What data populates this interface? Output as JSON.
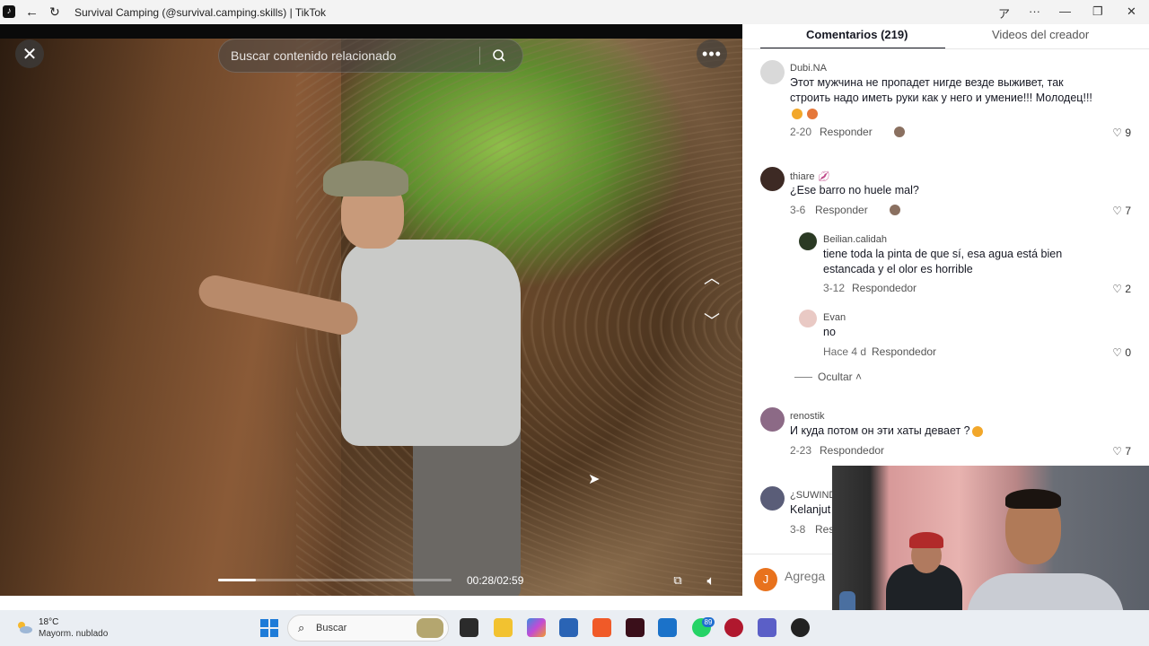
{
  "window": {
    "title": "Survival Camping (@survival.camping.skills) | TikTok"
  },
  "video": {
    "search_placeholder": "Buscar contenido relacionado",
    "time": "00:28/02:59",
    "progress_fraction": 0.16
  },
  "comments_panel": {
    "tabs": [
      {
        "label": "Comentarios (219)"
      },
      {
        "label": "Videos del creador"
      }
    ],
    "comments": [
      {
        "username": "Dubi.NA",
        "text": "Этот мужчина не пропадет нигде везде выживет, так строить надо иметь руки как у него и умение!!! Молодец!!!",
        "date": "2-20",
        "reply_label": "Responder",
        "likes": "9"
      },
      {
        "username": "thiare",
        "text": "¿Ese barro no huele mal?",
        "date": "3-6",
        "reply_label": "Responder",
        "likes": "7"
      },
      {
        "username": "Beilian.calidah",
        "text": "tiene toda la pinta de que sí, esa agua está bien estancada y el olor es horrible",
        "date": "3-12",
        "reply_label": "Respondedor",
        "likes": "2"
      },
      {
        "username": "Evan",
        "text": "no",
        "date": "Hace 4 d",
        "reply_label": "Respondedor",
        "likes": "0"
      },
      {
        "username": "renostik",
        "text": "И куда потом он эти хаты девает ?",
        "date": "2-23",
        "reply_label": "Respondedor",
        "likes": "7"
      },
      {
        "username": "¿SUWIND",
        "text": "Kelanjut",
        "date": "3-8",
        "reply_label": "Res",
        "likes": ""
      }
    ],
    "hide_label": "Ocultar",
    "add_comment_placeholder": "Agrega",
    "user_initial": "J"
  },
  "taskbar": {
    "weather_temp": "18°C",
    "weather_desc": "Mayorm. nublado",
    "search_label": "Buscar",
    "whatsapp_badge": "89"
  }
}
